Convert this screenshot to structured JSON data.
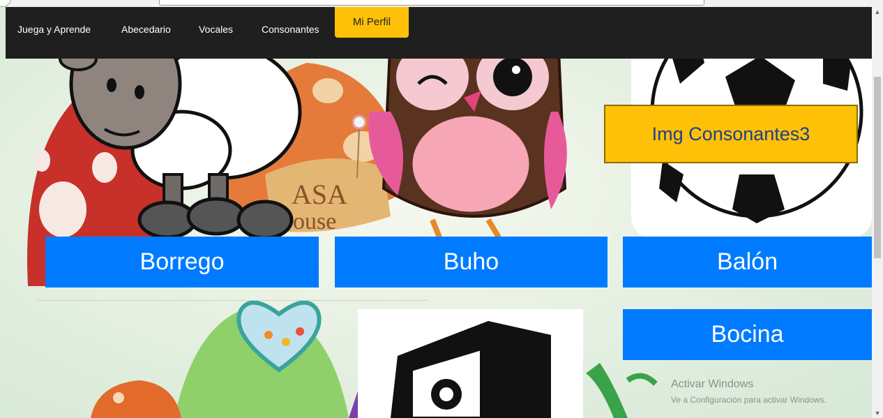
{
  "navbar": {
    "links": [
      {
        "label": "Juega y Aprende"
      },
      {
        "label": "Abecedario"
      },
      {
        "label": "Vocales"
      },
      {
        "label": "Consonantes"
      }
    ],
    "perfil": "Mi Perfil"
  },
  "cards": {
    "borrego": "Borrego",
    "buho": "Buho",
    "balon": "Balón",
    "bocina": "Bocina",
    "img_placeholder": "Img Consonantes3"
  },
  "background": {
    "sign_line1": "ASA",
    "sign_line2": "ouse"
  },
  "watermark": {
    "line1": "Activar Windows",
    "line2": "Ve a Configuración para activar Windows."
  },
  "colors": {
    "navbar": "#1f1f1f",
    "primary": "#007bff",
    "warning": "#ffc107"
  },
  "icons": [
    "sheep-illustration",
    "owl-illustration",
    "soccer-ball-image",
    "speaker-image",
    "heart-illustration",
    "mushroom-house-illustration"
  ]
}
